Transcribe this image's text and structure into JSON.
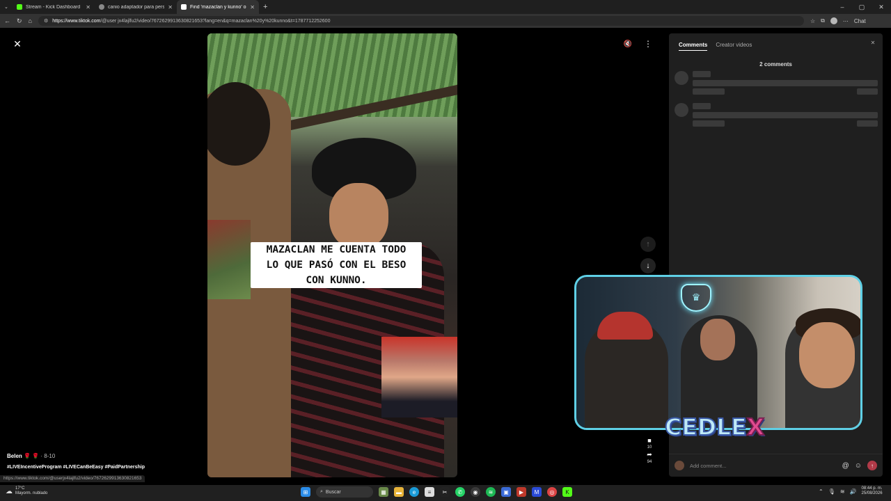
{
  "browser": {
    "tabs": [
      {
        "title": "Stream - Kick Dashboard",
        "favicon_color": "#53fc18",
        "active": false
      },
      {
        "title": "canio adaptador para persona de",
        "favicon_color": "#888888",
        "active": false
      },
      {
        "title": "Find 'mazaclan y kunno' on TikTo",
        "favicon_color": "#ffffff",
        "active": true
      }
    ],
    "new_tab": "+",
    "url_host": "https://www.tiktok.com",
    "url_path": "/@user jx4lajlfu2/video/7672629913630821653?lang=en&q=mazaclan%20y%20kunno&t=1787712252600",
    "profile_label": "Chat"
  },
  "video": {
    "caption": "MAZACLAN ME CUENTA TODO\nLO QUE PASÓ CON EL BESO\nCON KUNNO.",
    "author": "Belen",
    "author_emojis": "🌹 🌹",
    "meta": "· 8-10",
    "hashtags": "#LIVEIncentiveProgram #LIVECanBeEasy #PaidPartnership",
    "bookmarks": "10",
    "shares": "94",
    "status_url": "https://www.tiktok.com/@userjx4lajlfu2/video/7672629913630821653"
  },
  "comments_panel": {
    "tabs": [
      "Comments",
      "Creator videos"
    ],
    "count_label": "2 comments",
    "input_placeholder": "Add comment...",
    "send_color": "#b03a48"
  },
  "overlay": {
    "brand_main": "CEDLE",
    "brand_x": "X",
    "frame_color": "#5fd0e6"
  },
  "taskbar": {
    "weather_temp": "17°C",
    "weather_desc": "Mayorm. nublado",
    "search_label": "Buscar",
    "time": "08:44 p. m.",
    "date": "25/08/2026"
  }
}
